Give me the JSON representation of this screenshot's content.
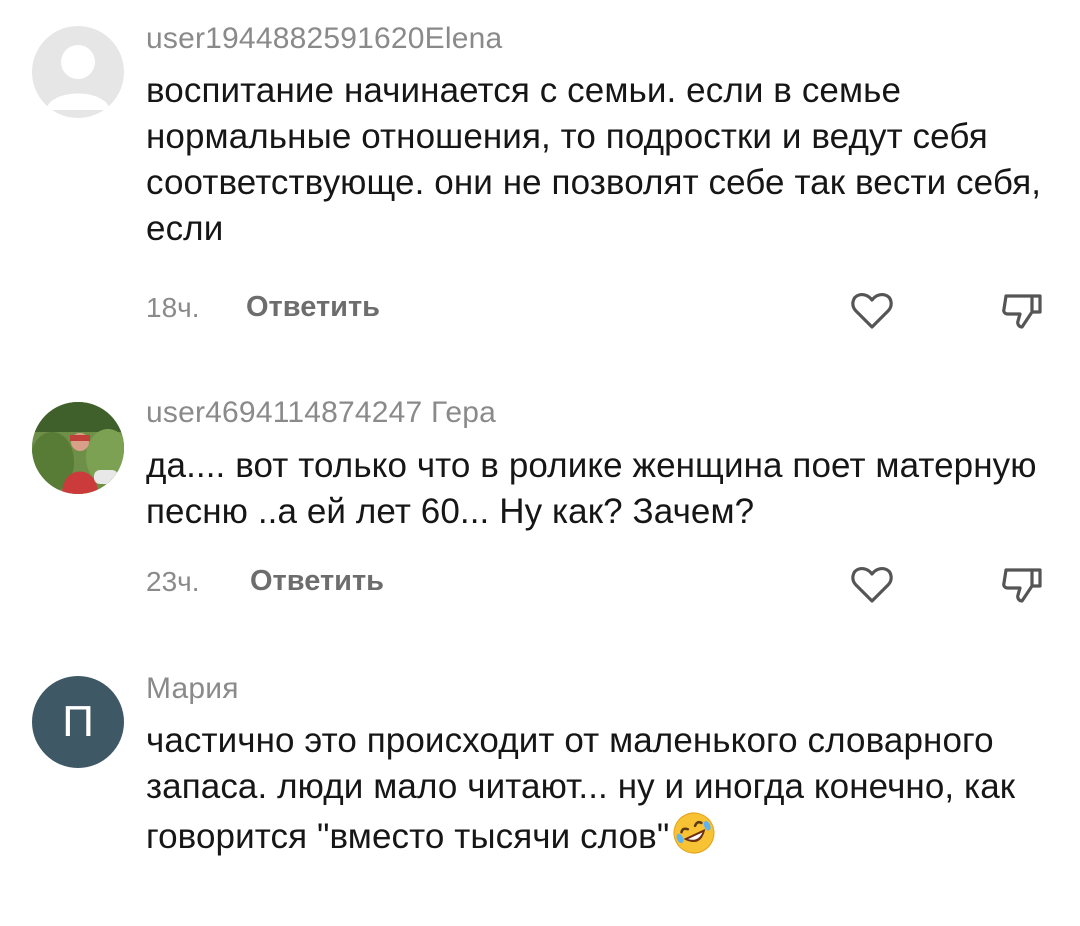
{
  "comments": [
    {
      "username": "user1944882591620Elena",
      "avatar": "default-avatar",
      "text": "воспитание начинается с семьи. если в семье нормальные отношения, то подростки и ведут себя соответствующе. они не позволят себе так вести себя, если",
      "time": "18ч.",
      "reply_label": "Ответить",
      "like_icon": "heart-outline-icon",
      "dislike_icon": "thumb-down-outline-icon"
    },
    {
      "username": "user4694114874247 Гера",
      "avatar": "photo-avatar",
      "text": "да.... вот только что в ролике женщина поет матерную песню ..а ей лет 60... Ну как? Зачем?",
      "time": "23ч.",
      "reply_label": "Ответить",
      "like_icon": "heart-outline-icon",
      "dislike_icon": "thumb-down-outline-icon"
    },
    {
      "username": "Мария",
      "avatar": "letter-avatar",
      "avatar_letter": "П",
      "text": "частично это происходит от маленького словарного запаса. люди мало читают... ну и иногда конечно, как говорится \"вместо тысячи слов\"",
      "emoji": "rolling-on-floor-laughing-emoji"
    }
  ],
  "colors": {
    "text": "#161616",
    "secondary": "#8a8a8a",
    "letter_avatar_bg": "#3f5866"
  }
}
